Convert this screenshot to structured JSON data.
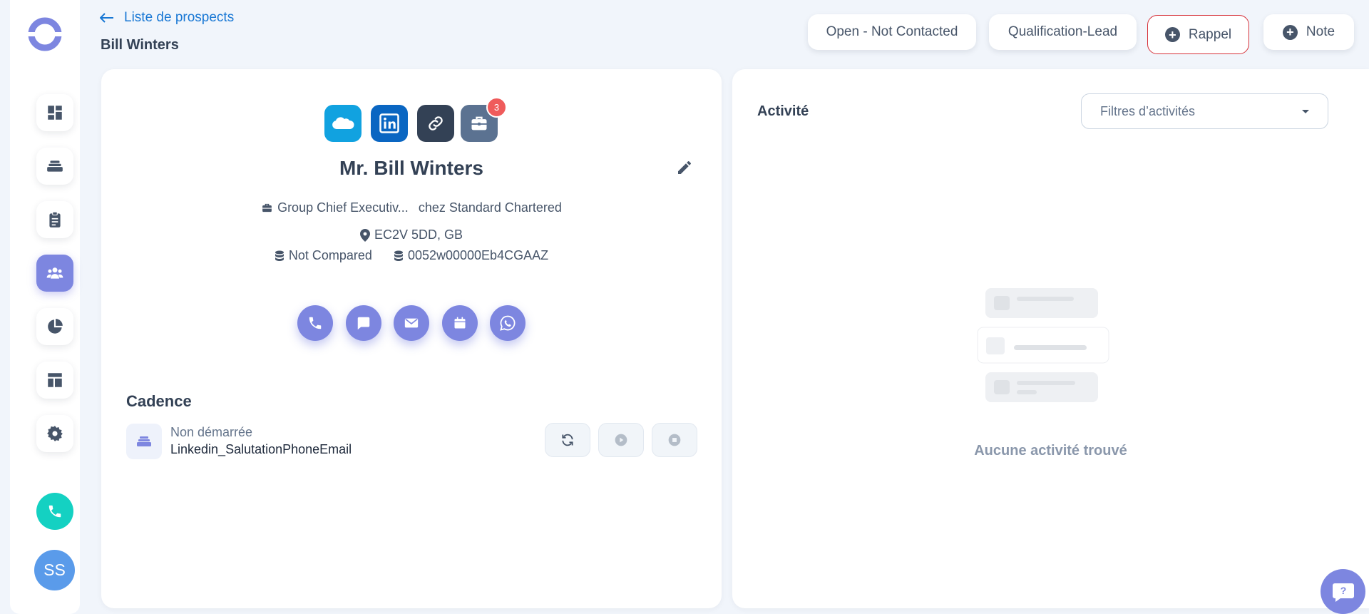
{
  "header": {
    "back_label": "Liste de prospects",
    "title": "Bill Winters",
    "status_button": "Open - Not Contacted",
    "stage_button": "Qualification-Lead",
    "rappel_button": "Rappel",
    "note_button": "Note"
  },
  "sidebar": {
    "items": [
      {
        "name": "dashboard-icon"
      },
      {
        "name": "layers-icon"
      },
      {
        "name": "clipboard-icon"
      },
      {
        "name": "users-icon",
        "active": true
      },
      {
        "name": "pie-chart-icon"
      },
      {
        "name": "layout-icon"
      },
      {
        "name": "gear-icon"
      }
    ],
    "avatar_initials": "SS"
  },
  "contact": {
    "name": "Mr. Bill Winters",
    "job_title": "Group Chief Executiv...",
    "company": "chez Standard Chartered",
    "location": "EC2V 5DD, GB",
    "compare_status": "Not Compared",
    "record_id": "0052w00000Eb4CGAAZ",
    "briefcase_badge": "3"
  },
  "cadence": {
    "title": "Cadence",
    "status": "Non démarrée",
    "name": "Linkedin_SalutationPhoneEmail"
  },
  "activity": {
    "title": "Activité",
    "filter_placeholder": "Filtres d’activités",
    "empty_text": "Aucune activité trouvé"
  },
  "colors": {
    "accent": "#7d86e0",
    "link": "#1877d4",
    "salesforce": "#11a2e0",
    "linkedin": "#0a66c2",
    "rappel_border": "#d6323a",
    "phone_green": "#14d1c2"
  }
}
